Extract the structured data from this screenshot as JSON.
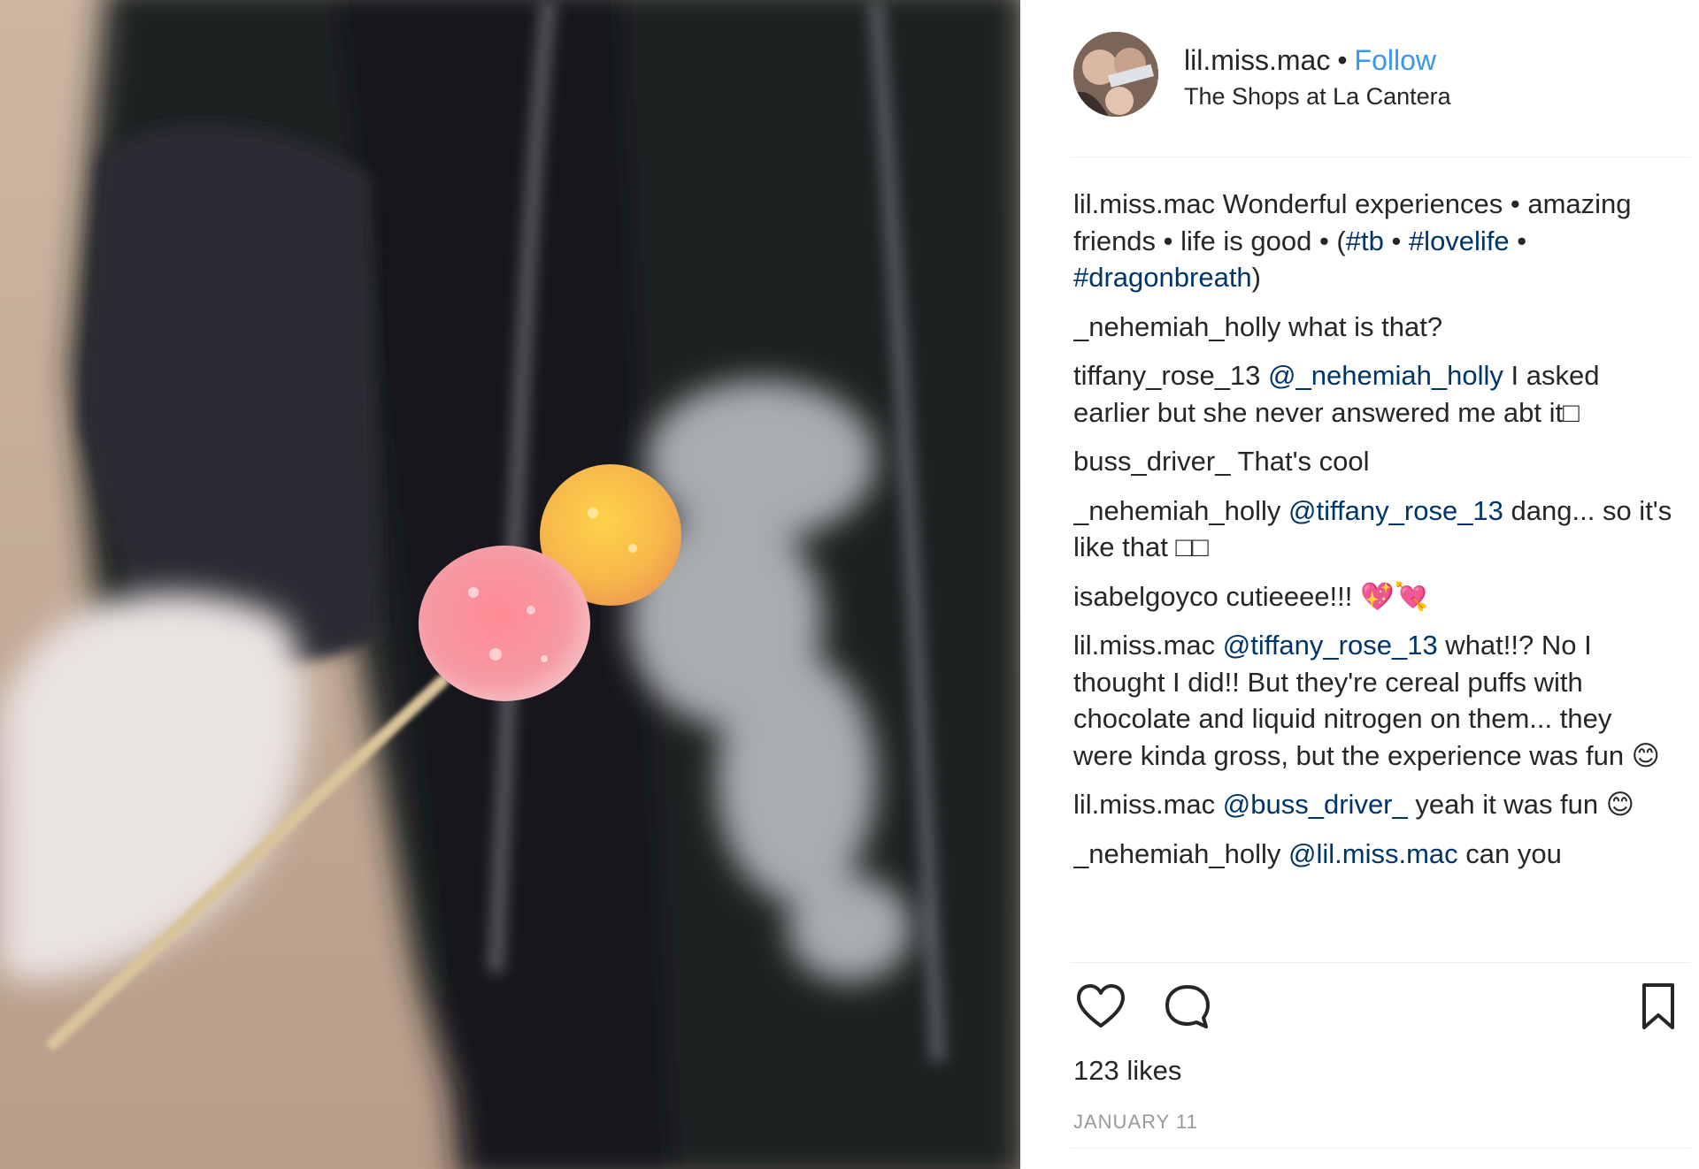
{
  "post": {
    "username": "lil.miss.mac",
    "separator": "•",
    "follow_label": "Follow",
    "location": "The Shops at La Cantera"
  },
  "comments": [
    {
      "user": "lil.miss.mac",
      "parts": [
        {
          "t": "text",
          "v": "Wonderful experiences • amazing friends • life is good • ("
        },
        {
          "t": "tag",
          "v": "#tb"
        },
        {
          "t": "text",
          "v": " • "
        },
        {
          "t": "tag",
          "v": "#lovelife"
        },
        {
          "t": "text",
          "v": " • "
        },
        {
          "t": "tag",
          "v": "#dragonbreath"
        },
        {
          "t": "text",
          "v": ")"
        }
      ]
    },
    {
      "user": "_nehemiah_holly",
      "parts": [
        {
          "t": "text",
          "v": "what is that?"
        }
      ]
    },
    {
      "user": "tiffany_rose_13",
      "parts": [
        {
          "t": "tag",
          "v": "@_nehemiah_holly"
        },
        {
          "t": "text",
          "v": " I asked earlier but she never answered me abt it□"
        }
      ]
    },
    {
      "user": "buss_driver_",
      "parts": [
        {
          "t": "text",
          "v": "That's cool"
        }
      ]
    },
    {
      "user": "_nehemiah_holly",
      "parts": [
        {
          "t": "tag",
          "v": "@tiffany_rose_13"
        },
        {
          "t": "text",
          "v": " dang... so it's like that □□"
        }
      ]
    },
    {
      "user": "isabelgoyco",
      "parts": [
        {
          "t": "text",
          "v": "cutieeee!!! 💖💘"
        }
      ]
    },
    {
      "user": "lil.miss.mac",
      "parts": [
        {
          "t": "tag",
          "v": "@tiffany_rose_13"
        },
        {
          "t": "text",
          "v": " what!!? No I thought I did!! But they're cereal puffs with chocolate and liquid nitrogen on them... they were kinda gross, but the experience was fun 😊"
        }
      ]
    },
    {
      "user": "lil.miss.mac",
      "parts": [
        {
          "t": "tag",
          "v": "@buss_driver_"
        },
        {
          "t": "text",
          "v": " yeah it was fun 😊"
        }
      ]
    },
    {
      "user": "_nehemiah_holly",
      "parts": [
        {
          "t": "tag",
          "v": "@lil.miss.mac"
        },
        {
          "t": "text",
          "v": " can you"
        }
      ]
    }
  ],
  "actions": {
    "like_icon": "heart-icon",
    "comment_icon": "speech-bubble-icon",
    "save_icon": "bookmark-icon"
  },
  "likes_text": "123 likes",
  "date_text": "JANUARY 11",
  "colors": {
    "link_blue": "#3897f0",
    "tag_navy": "#003569",
    "text": "#262626",
    "muted": "#999999"
  }
}
